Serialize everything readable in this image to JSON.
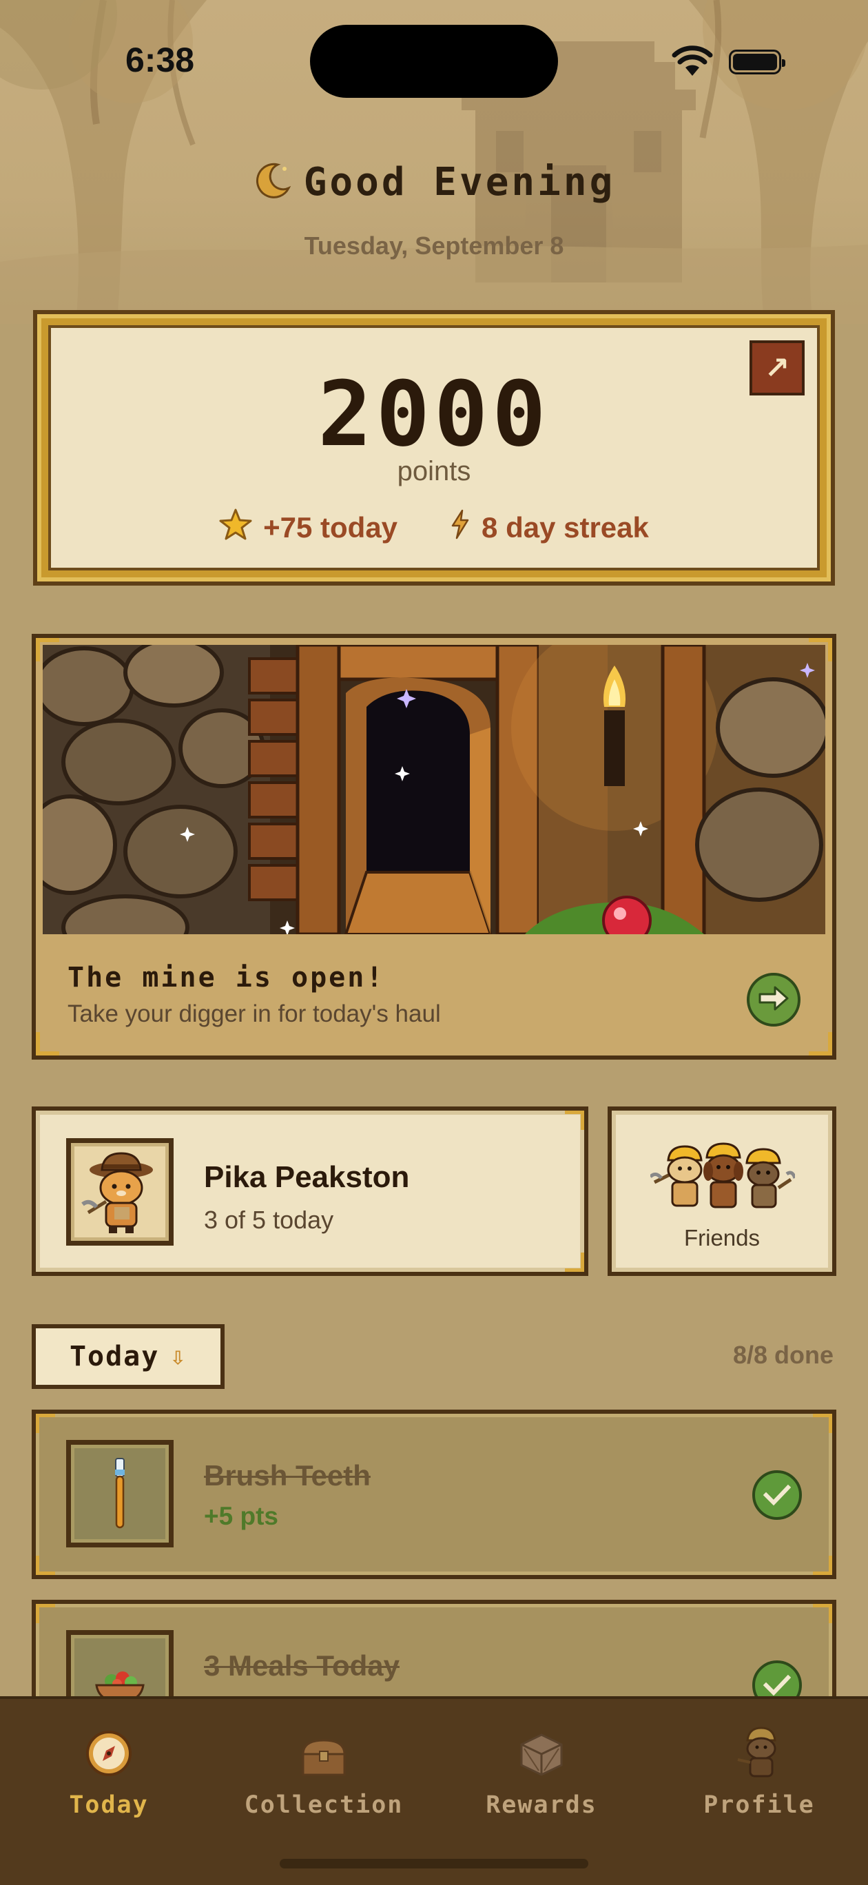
{
  "status_bar": {
    "time": "6:38"
  },
  "header": {
    "greeting": "Good Evening",
    "date": "Tuesday, September 8"
  },
  "points_card": {
    "value": "2000",
    "label": "points",
    "today": "+75 today",
    "streak": "8 day streak",
    "expand_icon": "arrow-up-right-icon"
  },
  "mine_card": {
    "title": "The mine is open!",
    "subtitle": "Take your digger in for today's haul",
    "action_icon": "arrow-right-icon"
  },
  "profile": {
    "name": "Pika Peakston",
    "progress": "3 of 5 today"
  },
  "friends": {
    "label": "Friends"
  },
  "list": {
    "filter_label": "Today",
    "filter_icon": "arrow-down-icon",
    "done_count": "8/8 done"
  },
  "tasks": [
    {
      "title": "Brush Teeth",
      "points": "+5 pts",
      "icon": "toothbrush-icon",
      "completed": true
    },
    {
      "title": "3 Meals Today",
      "points": "",
      "icon": "salad-bowl-icon",
      "completed": true
    }
  ],
  "tabs": [
    {
      "label": "Today",
      "icon": "compass-icon",
      "active": true
    },
    {
      "label": "Collection",
      "icon": "chest-icon",
      "active": false
    },
    {
      "label": "Rewards",
      "icon": "crate-icon",
      "active": false
    },
    {
      "label": "Profile",
      "icon": "mole-miner-icon",
      "active": false
    }
  ],
  "colors": {
    "background": "#b69f70",
    "accent_gold": "#e1b54b",
    "streak_red": "#9a4a25",
    "success_green": "#5f9a3a",
    "tabbar": "#533a1d"
  }
}
